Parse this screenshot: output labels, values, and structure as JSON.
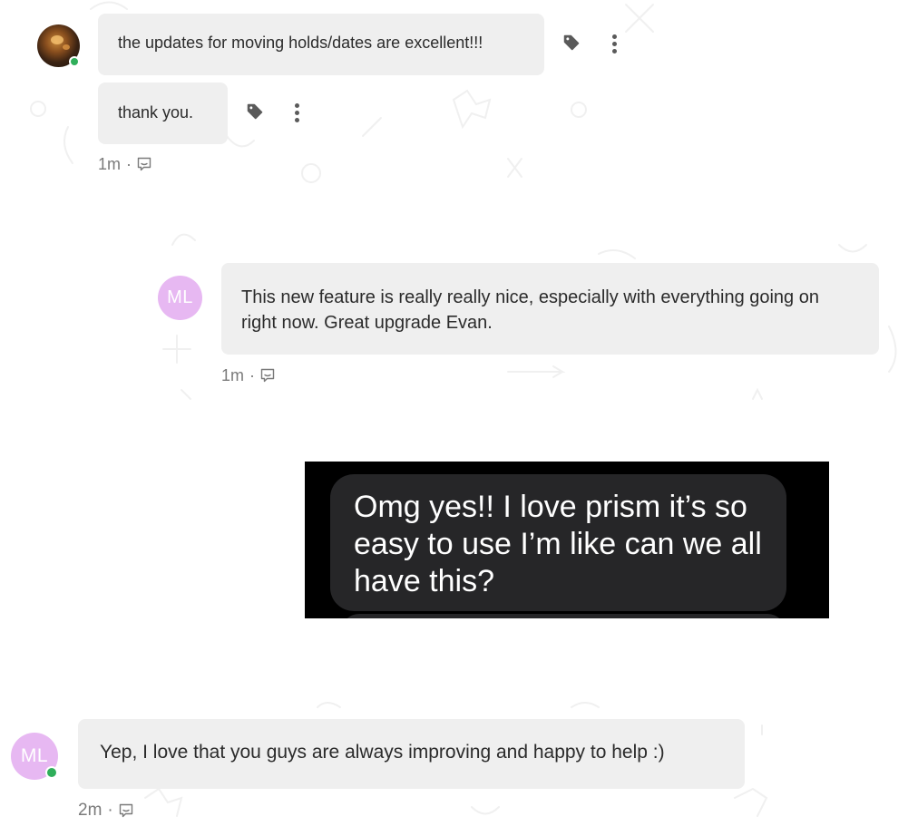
{
  "messages": [
    {
      "avatar": {
        "type": "photo",
        "online": true
      },
      "bubbles": [
        {
          "text": "the updates for moving holds/dates are excellent!!!"
        },
        {
          "text": "thank you."
        }
      ],
      "time": "1m",
      "separator": "·"
    },
    {
      "avatar": {
        "type": "initials",
        "initials": "ML",
        "color": "#e7b8f2",
        "online": false
      },
      "bubbles": [
        {
          "text": "This new feature is really really nice, especially with everything going on right now. Great upgrade Evan."
        }
      ],
      "time": "1m",
      "separator": "·"
    },
    {
      "attachment": {
        "type": "image",
        "embedded_text": "Omg yes!! I love prism it’s so easy to use I’m like can we all have this?"
      }
    },
    {
      "avatar": {
        "type": "initials",
        "initials": "ML",
        "color": "#e7b8f2",
        "online": true
      },
      "bubbles": [
        {
          "text": "Yep, I love that you guys are always improving and happy to help :)"
        }
      ],
      "time": "2m",
      "separator": "·"
    }
  ],
  "colors": {
    "bubble_bg": "#efefef",
    "online_status": "#2fae5a",
    "avatar_ml": "#e7b8f2",
    "timestamp": "#7a7a7a"
  },
  "icons": {
    "tag": "tag-icon",
    "more": "more-vertical-icon",
    "reply": "reply-icon"
  }
}
